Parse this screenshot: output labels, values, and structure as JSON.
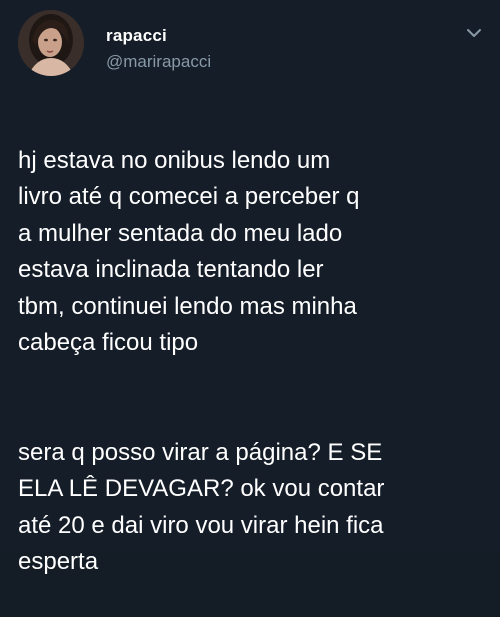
{
  "user": {
    "display_name": "rapacci",
    "handle": "@marirapacci",
    "avatar_icon": "profile-photo"
  },
  "menu": {
    "caret_icon": "chevron-down-icon"
  },
  "tweet": {
    "paragraph1": "hj estava no onibus lendo um\nlivro até q comecei a perceber q\na mulher sentada do meu lado\nestava inclinada tentando ler\ntbm, continuei lendo mas minha\ncabeça ficou tipo",
    "paragraph2": "sera q posso virar a página? E SE\nELA LÊ DEVAGAR? ok vou contar\naté 20 e dai viro vou virar hein fica\nesperta"
  },
  "colors": {
    "background": "#151d28",
    "text": "#ffffff",
    "muted": "#8899a6"
  }
}
